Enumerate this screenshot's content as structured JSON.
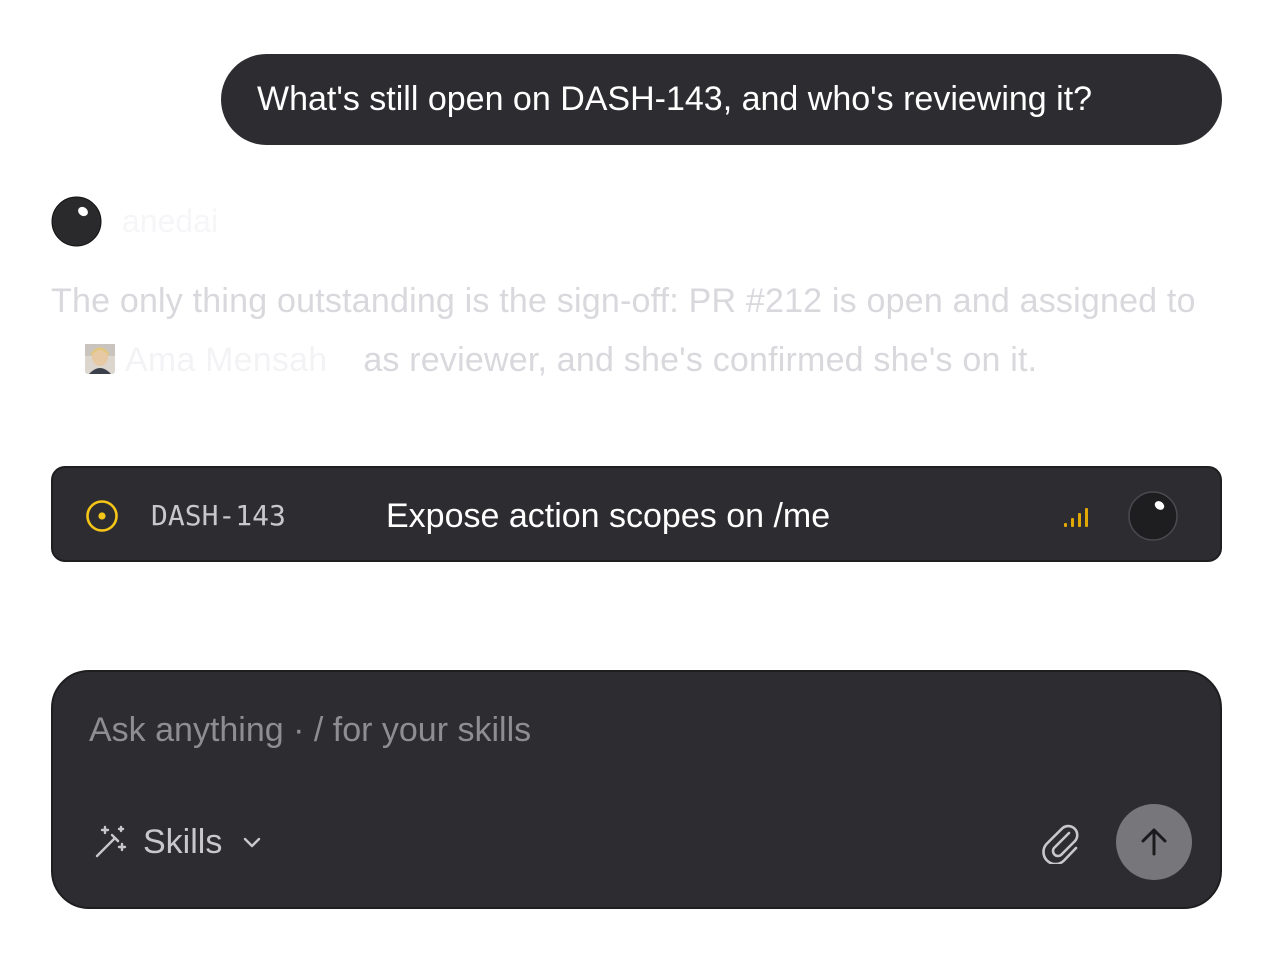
{
  "conversation": {
    "user_message": "What's still open on DASH-143, and who's reviewing it?",
    "assistant": {
      "name": "anedai",
      "message_part1": "The only thing outstanding is the sign-off: PR #212 is open and assigned to",
      "mention_name": "Ama Mensah",
      "message_part2": "as reviewer, and she's confirmed she's on it."
    }
  },
  "issue_card": {
    "id": "DASH-143",
    "title": "Expose action scopes on /me",
    "status_color": "#f5c518",
    "priority_color": "#e0a800"
  },
  "composer": {
    "placeholder": "Ask anything · / for your skills",
    "skills_label": "Skills"
  },
  "icons": {
    "assistant_avatar": "orb-icon",
    "status": "in-progress-circle-icon",
    "priority": "priority-bars-icon",
    "assignee": "orb-icon",
    "skills": "magic-wand-icon",
    "dropdown": "chevron-down-icon",
    "attach": "paperclip-icon",
    "send": "arrow-up-icon"
  }
}
